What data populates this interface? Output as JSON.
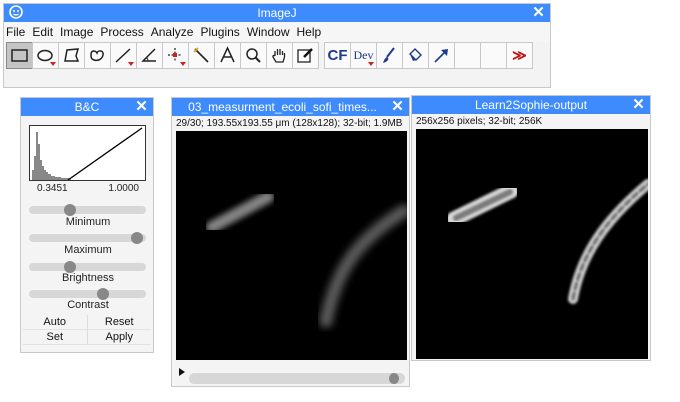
{
  "main_window": {
    "title": "ImageJ",
    "menu": [
      "File",
      "Edit",
      "Image",
      "Process",
      "Analyze",
      "Plugins",
      "Window",
      "Help"
    ],
    "tools": [
      "rectangle",
      "oval",
      "polygon",
      "freehand",
      "line",
      "angle",
      "point",
      "wand",
      "text",
      "magnifier",
      "scroll",
      "color-picker",
      "CF",
      "Dev",
      "brush",
      "flood-fill",
      "arrow",
      "",
      "",
      "more"
    ],
    "tool_text": {
      "cf": "CF",
      "dev": "Dev"
    },
    "more_label": "≫"
  },
  "bc_window": {
    "title": "B&C",
    "histogram_min": "0.3451",
    "histogram_max": "1.0000",
    "sliders": [
      {
        "label": "Minimum",
        "level": 0.33
      },
      {
        "label": "Maximum",
        "level": 0.97
      },
      {
        "label": "Brightness",
        "level": 0.33
      },
      {
        "label": "Contrast",
        "level": 0.65
      }
    ],
    "buttons": {
      "auto": "Auto",
      "reset": "Reset",
      "set": "Set",
      "apply": "Apply"
    }
  },
  "image_window_1": {
    "title": "03_measurment_ecoli_sofi_times...",
    "info": "29/30; 193.55x193.55 μm (128x128); 32-bit; 1.9MB",
    "slice_position": 0.97
  },
  "image_window_2": {
    "title": "Learn2Sophie-output",
    "info": "256x256 pixels; 32-bit; 256K"
  }
}
